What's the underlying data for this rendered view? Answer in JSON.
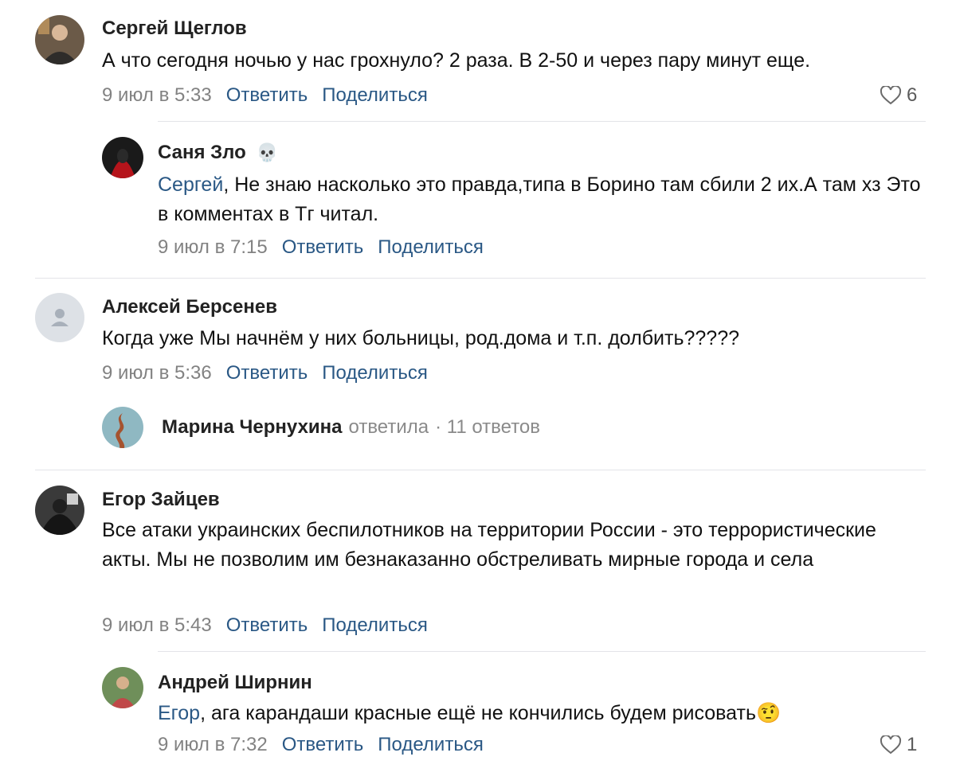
{
  "comments": [
    {
      "author": "Сергей Щеглов",
      "text": "А что сегодня ночью у нас грохнуло? 2 раза. В 2-50 и через пару минут еще.",
      "date": "9 июл в 5:33",
      "reply_label": "Ответить",
      "share_label": "Поделиться",
      "likes": "6"
    },
    {
      "author": "Саня Зло",
      "author_badge": "skull-icon",
      "mention": "Сергей",
      "text": ", Не знаю насколько это правда,типа в Борино там сбили 2 их.А там хз Это в комментах в Тг читал.",
      "date": "9 июл в 7:15",
      "reply_label": "Ответить",
      "share_label": "Поделиться"
    },
    {
      "author": "Алексей Берсенев",
      "text": "Когда уже Мы начнём у них больницы, род.дома и т.п. долбить?????",
      "date": "9 июл в 5:36",
      "reply_label": "Ответить",
      "share_label": "Поделиться"
    },
    {
      "author": "Егор Зайцев",
      "text": "Все атаки украинских беспилотников на территории России - это террористические акты. Мы не позволим им безнаказанно обстреливать мирные города и села",
      "date": "9 июл в 5:43",
      "reply_label": "Ответить",
      "share_label": "Поделиться"
    },
    {
      "author": "Андрей Ширнин",
      "mention": "Егор",
      "text": ", ага карандаши красные ещё не кончились будем рисовать",
      "emoji": "🤨",
      "date": "9 июл в 7:32",
      "reply_label": "Ответить",
      "share_label": "Поделиться",
      "likes": "1"
    }
  ],
  "replies_summary": {
    "name": "Марина Чернухина",
    "action": "ответила",
    "count": "· 11 ответов"
  },
  "colors": {
    "link": "#2a5885",
    "meta": "#828282",
    "divider": "#e3e4e8"
  }
}
